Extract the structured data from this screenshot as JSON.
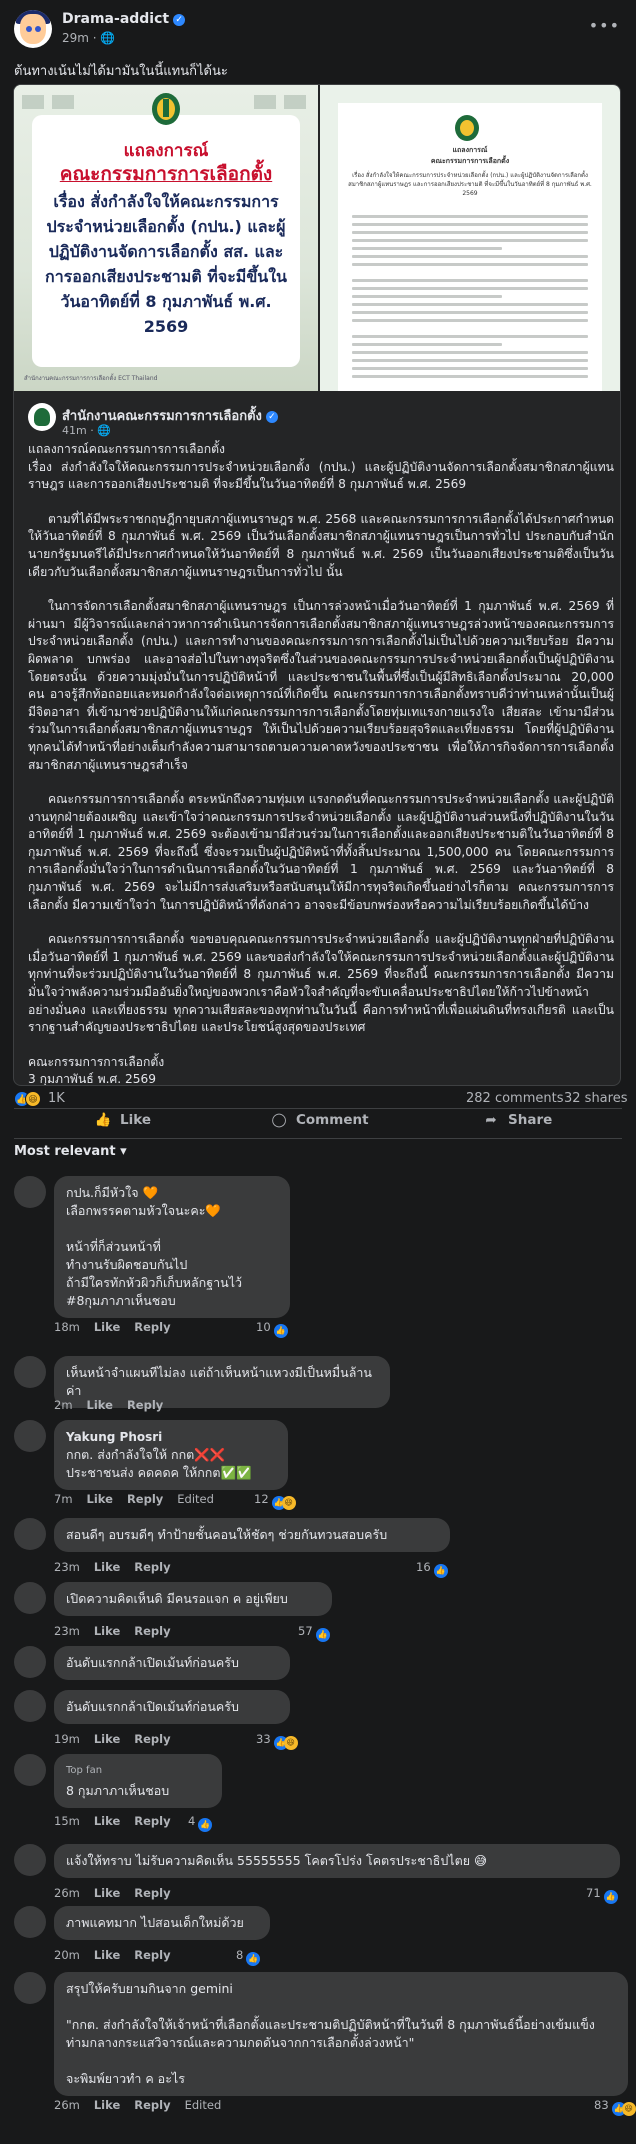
{
  "post": {
    "author": "Drama-addict",
    "time": "29m",
    "privacy_icon": "globe-icon",
    "caption": "ต้นทางเน้นไม่ได้มามันในนี้แทนก็ได้นะ"
  },
  "shared_post": {
    "image_left": {
      "title1": "แถลงการณ์",
      "title2": "คณะกรรมการการเลือกตั้ง",
      "body": "เรื่อง สั่งกำลังใจให้คณะกรรมการประจำหน่วยเลือกตั้ง (กปน.) และผู้ปฏิบัติงานจัดการเลือกตั้ง สส. และการออกเสียงประชามติ ที่จะมีขึ้นในวันอาทิตย์ที่ 8 กุมภาพันธ์ พ.ศ. 2569",
      "footer": "สำนักงานคณะกรรมการการเลือกตั้ง  ECT Thailand"
    },
    "image_right": {
      "doc_title": "แถลงการณ์\nคณะกรรมการการเลือกตั้ง",
      "doc_subtitle": "เรื่อง สั่งกำลังใจให้คณะกรรมการประจำหน่วยเลือกตั้ง (กปน.) และผู้ปฏิบัติงานจัดการเลือกตั้งสมาชิกสภาผู้แทนราษฎร และการออกเสียงประชามติ ที่จะมีขึ้นในวันอาทิตย์ที่ 8 กุมภาพันธ์ พ.ศ. 2569"
    },
    "page_name": "สำนักงานคณะกรรมการการเลือกตั้ง",
    "time": "41m",
    "paragraphs": [
      "แถลงการณ์คณะกรรมการการเลือกตั้ง\nเรื่อง ส่งกำลังใจให้คณะกรรมการประจำหน่วยเลือกตั้ง (กปน.) และผู้ปฏิบัติงานจัดการเลือกตั้งสมาชิกสภาผู้แทนราษฎร และการออกเสียงประชามติ ที่จะมีขึ้นในวันอาทิตย์ที่ 8 กุมภาพันธ์ พ.ศ. 2569",
      "ตามที่ได้มีพระราชกฤษฎีกายุบสภาผู้แทนราษฎร พ.ศ. 2568 และคณะกรรมการการเลือกตั้งได้ประกาศกำหนดให้วันอาทิตย์ที่ 8 กุมภาพันธ์ พ.ศ. 2569 เป็นวันเลือกตั้งสมาชิกสภาผู้แทนราษฎรเป็นการทั่วไป ประกอบกับสำนักนายกรัฐมนตรีได้มีประกาศกำหนดให้วันอาทิตย์ที่ 8 กุมภาพันธ์ พ.ศ. 2569 เป็นวันออกเสียงประชามติซึ่งเป็นวันเดียวกับวันเลือกตั้งสมาชิกสภาผู้แทนราษฎรเป็นการทั่วไป นั้น",
      "ในการจัดการเลือกตั้งสมาชิกสภาผู้แทนราษฎร เป็นการล่วงหน้าเมื่อวันอาทิตย์ที่ 1 กุมภาพันธ์ พ.ศ. 2569 ที่ผ่านมา มีผู้วิจารณ์และกล่าวหาการดำเนินการจัดการเลือกตั้งสมาชิกสภาผู้แทนราษฎรล่วงหน้าของคณะกรรมการประจำหน่วยเลือกตั้ง (กปน.) และการทำงานของคณะกรรมการการเลือกตั้งไม่เป็นไปด้วยความเรียบร้อย มีความผิดพลาด บกพร่อง และอาจส่อไปในทางทุจริตซึ่งในส่วนของคณะกรรมการประจำหน่วยเลือกตั้งเป็นผู้ปฏิบัติงานโดยตรงนั้น ด้วยความมุ่งมั่นในการปฏิบัติหน้าที่ และประชาชนในพื้นที่ซึ่งเป็นผู้มีสิทธิเลือกตั้งประมาณ 20,000 คน อาจรู้สึกท้อถอยและหมดกำลังใจต่อเหตุการณ์ที่เกิดขึ้น คณะกรรมการการเลือกตั้งทราบดีว่าท่านเหล่านั้นเป็นผู้มีจิตอาสา ที่เข้ามาช่วยปฏิบัติงานให้แก่คณะกรรมการการเลือกตั้งโดยทุ่มเทแรงกายแรงใจ เสียสละ เข้ามามีส่วนร่วมในการเลือกตั้งสมาชิกสภาผู้แทนราษฎร ให้เป็นไปด้วยความเรียบร้อยสุจริตและเที่ยงธรรม โดยที่ผู้ปฏิบัติงานทุกคนได้ทำหน้าที่อย่างเต็มกำลังความสามารถตามความคาดหวังของประชาชน เพื่อให้ภารกิจจัดการการเลือกตั้งสมาชิกสภาผู้แทนราษฎรสำเร็จ",
      "คณะกรรมการการเลือกตั้ง ตระหนักถึงความทุ่มเท แรงกดดันที่คณะกรรมการประจำหน่วยเลือกตั้ง และผู้ปฏิบัติงานทุกฝ่ายต้องเผชิญ และเข้าใจว่าคณะกรรมการประจำหน่วยเลือกตั้ง และผู้ปฏิบัติงานส่วนหนึ่งที่ปฏิบัติงานในวันอาทิตย์ที่ 1 กุมภาพันธ์ พ.ศ. 2569 จะต้องเข้ามามีส่วนร่วมในการเลือกตั้งและออกเสียงประชามติในวันอาทิตย์ที่ 8 กุมภาพันธ์ พ.ศ. 2569 ที่จะถึงนี้ ซึ่งจะรวมเป็นผู้ปฏิบัติหน้าที่ทั้งสิ้นประมาณ 1,500,000 คน โดยคณะกรรมการการเลือกตั้งมั่นใจว่าในการดำเนินการเลือกตั้งในวันอาทิตย์ที่ 1 กุมภาพันธ์ พ.ศ. 2569 และวันอาทิตย์ที่ 8 กุมภาพันธ์ พ.ศ. 2569 จะไม่มีการส่งเสริมหรือสนับสนุนให้มีการทุจริตเกิดขึ้นอย่างไรก็ตาม คณะกรรมการการเลือกตั้ง มีความเข้าใจว่า ในการปฏิบัติหน้าที่ดังกล่าว อาจจะมีข้อบกพร่องหรือความไม่เรียบร้อยเกิดขึ้นได้บ้าง",
      "คณะกรรมการการเลือกตั้ง ขอขอบคุณคณะกรรมการประจำหน่วยเลือกตั้ง และผู้ปฏิบัติงานทุกฝ่ายที่ปฏิบัติงานเมื่อวันอาทิตย์ที่ 1 กุมภาพันธ์ พ.ศ. 2569 และขอส่งกำลังใจให้คณะกรรมการประจำหน่วยเลือกตั้งและผู้ปฏิบัติงานทุกท่านที่จะร่วมปฏิบัติงานในวันอาทิตย์ที่ 8 กุมภาพันธ์ พ.ศ. 2569 ที่จะถึงนี้ คณะกรรมการการเลือกตั้ง มีความมั่นใจว่าพลังความร่วมมืออันยิ่งใหญ่ของพวกเราคือหัวใจสำคัญที่จะขับเคลื่อนประชาธิปไตยให้ก้าวไปข้างหน้าอย่างมั่นคง และเที่ยงธรรม ทุกความเสียสละของทุกท่านในวันนี้ คือการทำหน้าที่เพื่อแผ่นดินที่ทรงเกียรติ และเป็นรากฐานสำคัญของประชาธิปไตย และประโยชน์สูงสุดของประเทศ"
    ],
    "signature": "คณะกรรมการการเลือกตั้ง\n3 กุมภาพันธ์ พ.ศ. 2569"
  },
  "stats": {
    "reactions": "1K",
    "comments": "282 comments",
    "shares": "32 shares"
  },
  "actions": {
    "like": "Like",
    "comment": "Comment",
    "share": "Share"
  },
  "sort_label": "Most relevant",
  "comments": [
    {
      "name": "",
      "text": "กปน.ก็มีหัวใจ 🧡\nเลือกพรรคตามหัวใจนะคะ🧡\n\nหน้าที่ก็ส่วนหน้าที่\nทำงานรับผิดชอบกันไป\nถ้ามีใครทักหัวผิวก็เก็บหลักฐานไว้\n#8กุมภาภาเห็นชอบ",
      "time": "18m",
      "edited": "",
      "count": "10"
    },
    {
      "name": "",
      "text": "เห็นหน้าจำแผนทีไม่ลง แต่ถ้าเห็นหน้าแหวงมีเป็นหมื่นล้านค่า",
      "time": "2m",
      "edited": "",
      "count": ""
    },
    {
      "name": "Yakung Phosri",
      "text": "กกต. ส่งกำลังใจให้ กกต❌❌\nประชาชนส่ง คดคดค ให้กกต✅✅",
      "time": "7m",
      "edited": "Edited",
      "count": "12"
    },
    {
      "name": "",
      "text": "สอนดีๆ อบรมดีๆ ทำป้ายชั้นคอนให้ชัดๆ ช่วยกันทวนสอบครับ",
      "time": "23m",
      "edited": "",
      "count": "16"
    },
    {
      "name": "",
      "text": "เปิดความคิดเห็นดิ มีคนรอแจก ค อยู่เพียบ",
      "time": "23m",
      "edited": "",
      "count": "57"
    },
    {
      "name": "",
      "text": "อันดับแรกกล้าเปิดเม้นท์ก่อนครับ",
      "time": "",
      "edited": "",
      "count": ""
    },
    {
      "name": "",
      "text": "อันดับแรกกล้าเปิดเม้นท์ก่อนครับ",
      "time": "19m",
      "edited": "",
      "count": "33"
    },
    {
      "name": "",
      "topfan": "Top fan",
      "text": "8 กุมภาภาเห็นชอบ",
      "time": "15m",
      "edited": "",
      "count": "4"
    },
    {
      "name": "",
      "text": "แจ้งให้ทราบ ไม่รับความคิดเห็น 55555555 โคตรโปร่ง โคตรประชาธิปไตย 😅",
      "time": "26m",
      "edited": "",
      "count": "71"
    },
    {
      "name": "",
      "text": "ภาพแคทมาก ไปสอนเด็กใหม่ด้วย",
      "time": "20m",
      "edited": "",
      "count": "8"
    },
    {
      "name": "",
      "text": "สรุปให้ครับยามกินจาก gemini\n\n\"กกต. ส่งกำลังใจให้เจ้าหน้าที่เลือกตั้งและประชามติปฏิบัติหน้าที่ในวันที่ 8 กุมภาพันธ์นี้อย่างเข้มแข็ง ท่ามกลางกระแสวิจารณ์และความกดดันจากการเลือกตั้งล่วงหน้า\"\n\nจะพิมพ์ยาวทำ ค อะไร",
      "time": "26m",
      "edited": "Edited",
      "count": "83"
    }
  ],
  "comment_actions": {
    "like": "Like",
    "reply": "Reply"
  },
  "colors": {
    "background": "#18191a",
    "bubble": "#3a3b3c",
    "accent": "#2d88ff",
    "title_red": "#c8102e"
  }
}
